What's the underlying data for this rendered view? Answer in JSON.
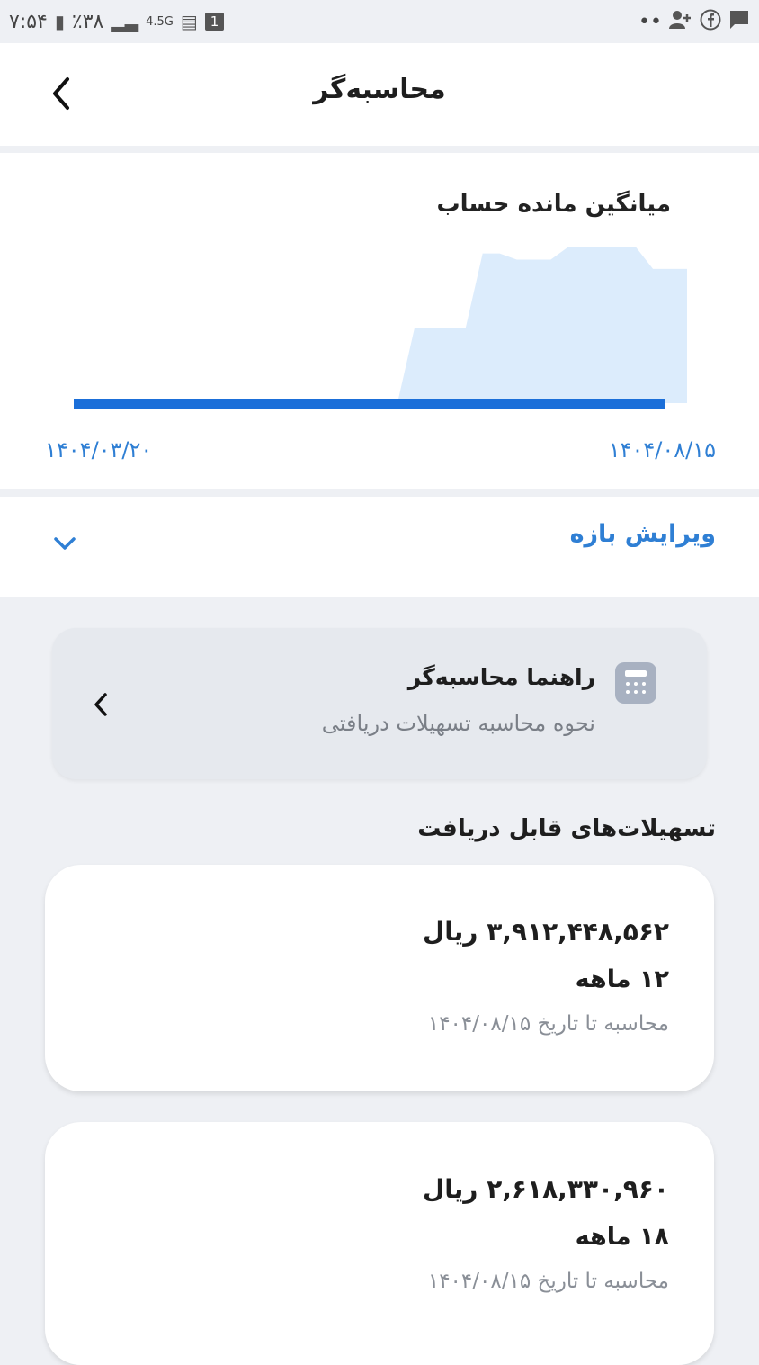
{
  "status_bar": {
    "time": "۷:۵۴",
    "battery": "٪۳۸",
    "network": "4.5G",
    "sim_badge": "1",
    "dots": "••"
  },
  "header": {
    "title": "محاسبه‌گر"
  },
  "chart_card": {
    "title": "میانگین مانده حساب",
    "start_date": "۱۴۰۴/۰۳/۲۰",
    "end_date": "۱۴۰۴/۰۸/۱۵"
  },
  "chart_data": {
    "type": "area",
    "x": [
      "۱۴۰۴/۰۳/۲۰",
      "۱۴۰۴/۰۸/۱۵"
    ],
    "series": [
      {
        "values": [
          0,
          0,
          0,
          0,
          0,
          0,
          0,
          0,
          0,
          0,
          0,
          0,
          0,
          0,
          0,
          0,
          0,
          0,
          0,
          0,
          0.48,
          0.48,
          0.48,
          0.48,
          0.96,
          0.96,
          0.92,
          0.92,
          0.92,
          1.0,
          1.0,
          1.0,
          1.0,
          1.0,
          0.86,
          0.86,
          0.86
        ]
      }
    ],
    "title": "میانگین مانده حساب",
    "xlabel": "",
    "ylabel": "",
    "ylim": [
      0,
      1.05
    ],
    "grid": false,
    "colors": {
      "area": "#dcecfc",
      "baseline": "#1b6fd9"
    }
  },
  "range_editor": {
    "label": "ویرایش بازه"
  },
  "guide": {
    "title": "راهنما محاسبه‌گر",
    "subtitle": "نحوه محاسبه تسهیلات دریافتی"
  },
  "loans_section": {
    "title": "تسهیلات‌های قابل دریافت",
    "items": [
      {
        "amount": "۳,۹۱۲,۴۴۸,۵۶۲ ریال",
        "term": "۱۲ ماهه",
        "calc_date": "محاسبه تا تاریخ ۱۴۰۴/۰۸/۱۵"
      },
      {
        "amount": "۲,۶۱۸,۳۳۰,۹۶۰ ریال",
        "term": "۱۸ ماهه",
        "calc_date": "محاسبه تا تاریخ ۱۴۰۴/۰۸/۱۵"
      }
    ]
  },
  "colors": {
    "accent": "#2f7fd4",
    "chart_fill": "#dcecfc",
    "chart_line": "#1b6fd9",
    "page_bg": "#eef0f4",
    "card_bg": "#ffffff"
  }
}
